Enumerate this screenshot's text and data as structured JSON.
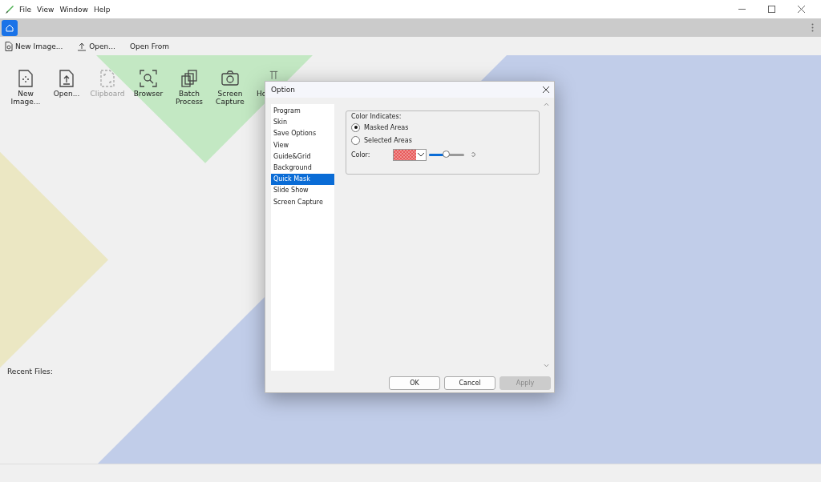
{
  "menu": [
    "File",
    "View",
    "Window",
    "Help"
  ],
  "home_tab": {
    "selected": true
  },
  "toolbar": [
    "New Image...",
    "Open...",
    "Open From"
  ],
  "tiles": [
    {
      "lines": [
        "New",
        "Image..."
      ],
      "disabled": false
    },
    {
      "lines": [
        "Open..."
      ],
      "disabled": false
    },
    {
      "lines": [
        "Clipboard"
      ],
      "disabled": true
    },
    {
      "lines": [
        "Browser"
      ],
      "disabled": false
    },
    {
      "lines": [
        "Batch",
        "Process"
      ],
      "disabled": false
    },
    {
      "lines": [
        "Screen",
        "Capture"
      ],
      "disabled": false
    },
    {
      "lines": [
        "Ho"
      ],
      "disabled": false
    }
  ],
  "recent_files_label": "Recent Files:",
  "dialog": {
    "title": "Option",
    "categories": [
      {
        "label": "Program",
        "selected": false
      },
      {
        "label": "Skin",
        "selected": false
      },
      {
        "label": "Save Options",
        "selected": false
      },
      {
        "label": "View",
        "selected": false
      },
      {
        "label": "Guide&Grid",
        "selected": false
      },
      {
        "label": "Background",
        "selected": false
      },
      {
        "label": "Quick Mask",
        "selected": true
      },
      {
        "label": "Slide Show",
        "selected": false
      },
      {
        "label": "Screen Capture",
        "selected": false
      }
    ],
    "group_title": "Color Indicates:",
    "radios": [
      {
        "label": "Masked Areas",
        "selected": true
      },
      {
        "label": "Selected Areas",
        "selected": false
      }
    ],
    "color_label": "Color:",
    "opacity": {
      "level": 0.5
    },
    "buttons": [
      {
        "label": "OK",
        "disabled": false
      },
      {
        "label": "Cancel",
        "disabled": false
      },
      {
        "label": "Apply",
        "disabled": true
      }
    ]
  }
}
